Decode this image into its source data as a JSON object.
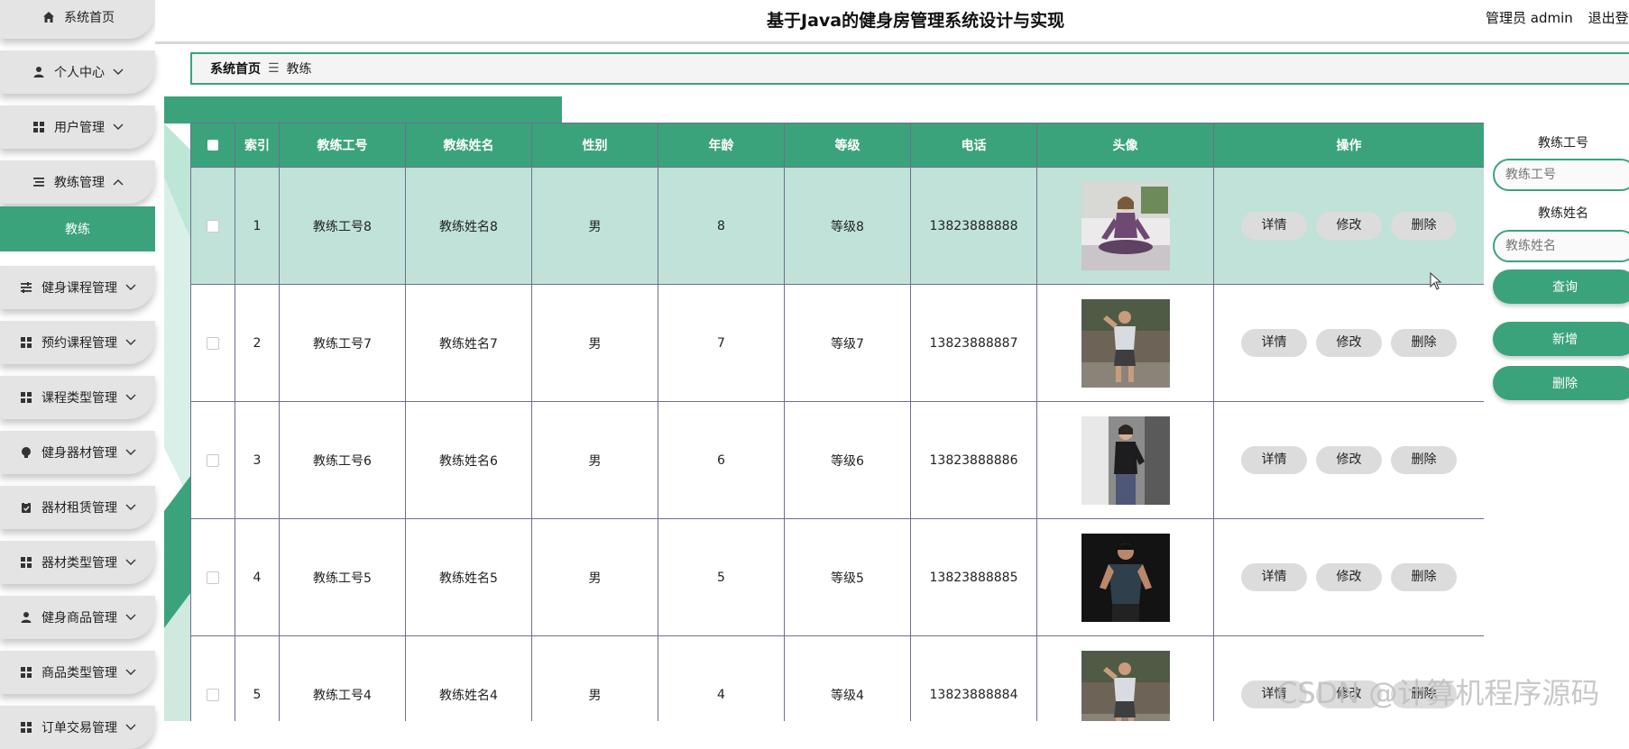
{
  "app": {
    "title": "基于Java的健身房管理系统设计与实现",
    "user_label": "管理员 admin",
    "logout_label": "退出登录"
  },
  "sidebar": {
    "items": [
      {
        "label": "系统首页",
        "icon": "home-icon"
      },
      {
        "label": "个人中心",
        "icon": "user-icon"
      },
      {
        "label": "用户管理",
        "icon": "grid-icon"
      },
      {
        "label": "教练管理",
        "icon": "list-icon"
      },
      {
        "label": "健身课程管理",
        "icon": "sliders-icon"
      },
      {
        "label": "预约课程管理",
        "icon": "grid-icon"
      },
      {
        "label": "课程类型管理",
        "icon": "grid-icon"
      },
      {
        "label": "健身器材管理",
        "icon": "bulb-icon"
      },
      {
        "label": "器材租赁管理",
        "icon": "clipboard-icon"
      },
      {
        "label": "器材类型管理",
        "icon": "grid-icon"
      },
      {
        "label": "健身商品管理",
        "icon": "user-icon"
      },
      {
        "label": "商品类型管理",
        "icon": "grid-icon"
      },
      {
        "label": "订单交易管理",
        "icon": "grid-icon"
      }
    ],
    "active_sub": "教练"
  },
  "breadcrumb": {
    "home": "系统首页",
    "separator": "☰",
    "current": "教练"
  },
  "table": {
    "columns": [
      "索引",
      "教练工号",
      "教练姓名",
      "性别",
      "年龄",
      "等级",
      "电话",
      "头像",
      "操作"
    ],
    "rows": [
      {
        "index": "1",
        "code": "教练工号8",
        "name": "教练姓名8",
        "gender": "男",
        "age": "8",
        "level": "等级8",
        "phone": "13823888888"
      },
      {
        "index": "2",
        "code": "教练工号7",
        "name": "教练姓名7",
        "gender": "男",
        "age": "7",
        "level": "等级7",
        "phone": "13823888887"
      },
      {
        "index": "3",
        "code": "教练工号6",
        "name": "教练姓名6",
        "gender": "男",
        "age": "6",
        "level": "等级6",
        "phone": "13823888886"
      },
      {
        "index": "4",
        "code": "教练工号5",
        "name": "教练姓名5",
        "gender": "男",
        "age": "5",
        "level": "等级5",
        "phone": "13823888885"
      },
      {
        "index": "5",
        "code": "教练工号4",
        "name": "教练姓名4",
        "gender": "男",
        "age": "4",
        "level": "等级4",
        "phone": "13823888884"
      }
    ],
    "actions": {
      "detail": "详情",
      "edit": "修改",
      "delete": "删除"
    }
  },
  "search": {
    "code_label": "教练工号",
    "code_placeholder": "教练工号",
    "name_label": "教练姓名",
    "name_placeholder": "教练姓名",
    "query_button": "查询",
    "add_button": "新增",
    "delete_button": "删除"
  },
  "watermark": "CSDN @计算机程序源码",
  "colors": {
    "accent": "#3aa37c",
    "selected_row": "#c0e2d8",
    "nav_bg": "#e4e4e4"
  }
}
